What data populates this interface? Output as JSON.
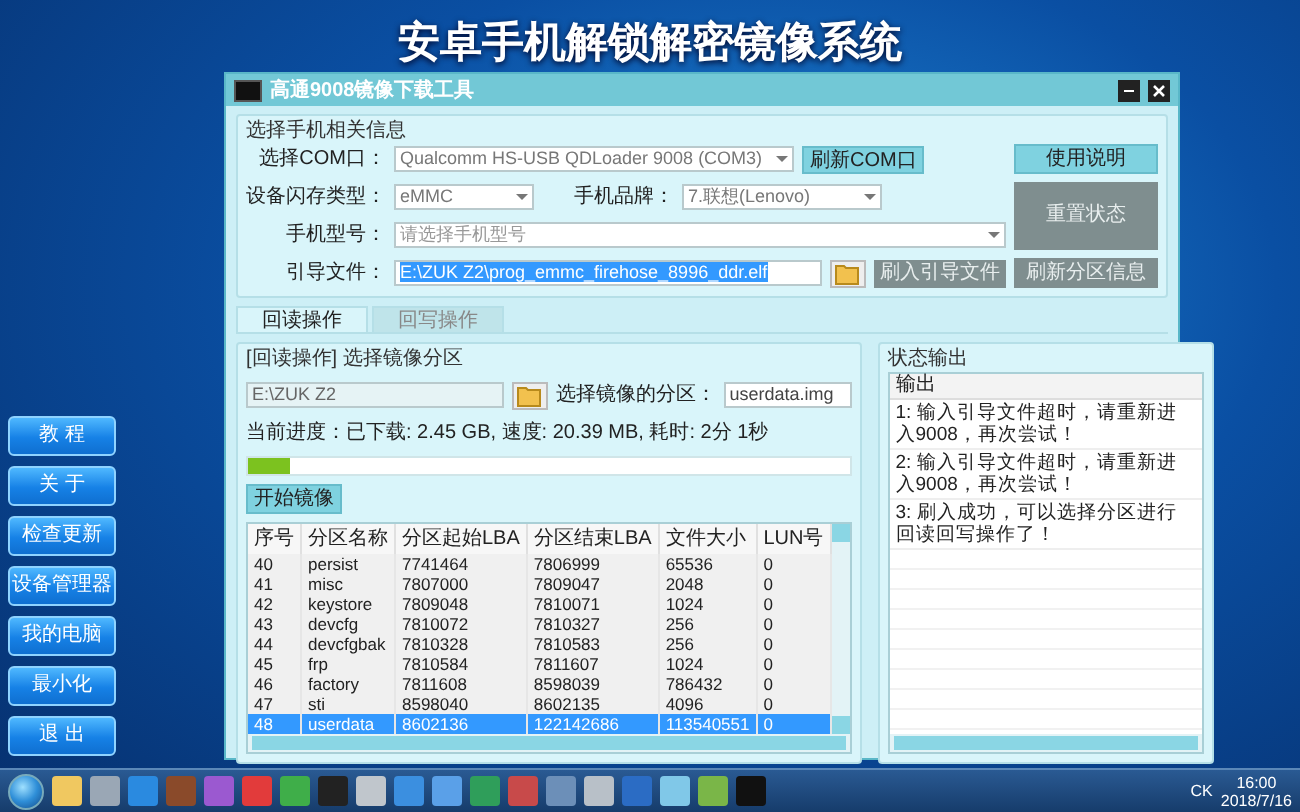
{
  "desktop_title": "安卓手机解锁解密镜像系统",
  "window": {
    "title": "高通9008镜像下载工具"
  },
  "phone_info": {
    "title": "选择手机相关信息",
    "com_port": {
      "label": "选择COM口：",
      "value": "Qualcomm HS-USB QDLoader 9008 (COM3)"
    },
    "refresh_com_button": {
      "label": "刷新COM口",
      "disabled": false
    },
    "flash_type": {
      "label": "设备闪存类型：",
      "value": "eMMC"
    },
    "brand": {
      "label": "手机品牌：",
      "value": "7.联想(Lenovo)"
    },
    "model": {
      "label": "手机型号：",
      "placeholder": "请选择手机型号"
    },
    "boot_file": {
      "label": "引导文件：",
      "value": "E:\\ZUK Z2\\prog_emmc_firehose_8996_ddr.elf"
    },
    "help_button": {
      "label": "使用说明",
      "disabled": false
    },
    "reset_button": {
      "label": "重置状态",
      "disabled": true
    },
    "flash_boot_button": {
      "label": "刷入引导文件",
      "disabled": true
    },
    "refresh_partitions_button": {
      "label": "刷新分区信息",
      "disabled": true
    }
  },
  "tabs": [
    {
      "label": "回读操作",
      "selected": true
    },
    {
      "label": "回写操作",
      "selected": false
    }
  ],
  "readback": {
    "title": "[回读操作] 选择镜像分区",
    "path": "E:\\ZUK Z2",
    "partition_label": "选择镜像的分区：",
    "partition_file": "userdata.img",
    "progress_text": "当前进度：已下载: 2.45 GB, 速度: 20.39 MB, 耗时: 2分 1秒",
    "progress": {
      "level": 0.07
    },
    "start_button": "开始镜像",
    "table": {
      "columns": [
        "序号",
        "分区名称",
        "分区起始LBA",
        "分区结束LBA",
        "文件大小",
        "LUN号"
      ],
      "rows": [
        {
          "cells": [
            "40",
            "persist",
            "7741464",
            "7806999",
            "65536",
            "0"
          ],
          "selected": false
        },
        {
          "cells": [
            "41",
            "misc",
            "7807000",
            "7809047",
            "2048",
            "0"
          ],
          "selected": false
        },
        {
          "cells": [
            "42",
            "keystore",
            "7809048",
            "7810071",
            "1024",
            "0"
          ],
          "selected": false
        },
        {
          "cells": [
            "43",
            "devcfg",
            "7810072",
            "7810327",
            "256",
            "0"
          ],
          "selected": false
        },
        {
          "cells": [
            "44",
            "devcfgbak",
            "7810328",
            "7810583",
            "256",
            "0"
          ],
          "selected": false
        },
        {
          "cells": [
            "45",
            "frp",
            "7810584",
            "7811607",
            "1024",
            "0"
          ],
          "selected": false
        },
        {
          "cells": [
            "46",
            "factory",
            "7811608",
            "8598039",
            "786432",
            "0"
          ],
          "selected": false
        },
        {
          "cells": [
            "47",
            "sti",
            "8598040",
            "8602135",
            "4096",
            "0"
          ],
          "selected": false
        },
        {
          "cells": [
            "48",
            "userdata",
            "8602136",
            "122142686",
            "113540551",
            "0"
          ],
          "selected": true
        }
      ]
    }
  },
  "status_output": {
    "title": "状态输出",
    "header": "输出",
    "lines": [
      "1: 输入引导文件超时，请重新进入9008，再次尝试！",
      "2: 输入引导文件超时，请重新进入9008，再次尝试！",
      "3: 刷入成功，可以选择分区进行回读回写操作了！"
    ]
  },
  "sidebar": {
    "items": [
      "教 程",
      "关 于",
      "检查更新",
      "设备管理器",
      "我的电脑",
      "最小化",
      "退 出"
    ]
  },
  "tray": {
    "input_indicator": "CK",
    "time": "16:00",
    "date": "2018/7/16"
  }
}
